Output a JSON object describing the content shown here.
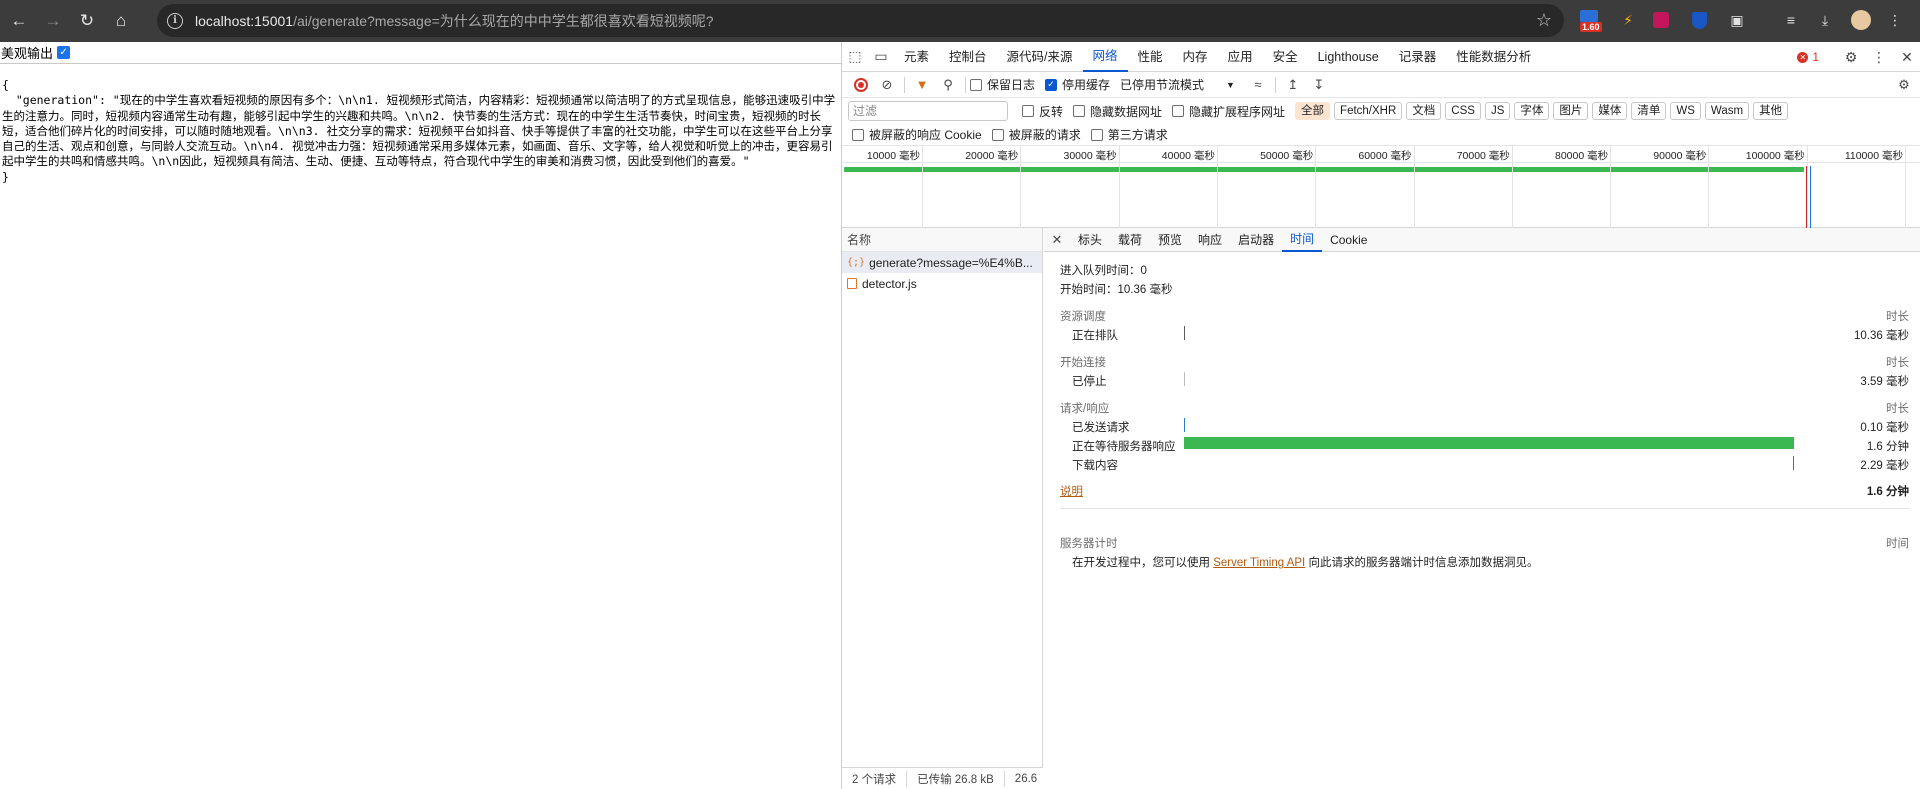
{
  "browser": {
    "url_host": "localhost:15001",
    "url_path": "/ai/generate?message=为什么现在的中中学生都很喜欢看短视频呢?",
    "ext_badge": "1.60"
  },
  "page": {
    "pretty_label": "美观输出",
    "json_text": "{\n  \"generation\": \"现在的中学生喜欢看短视频的原因有多个：\\n\\n1. 短视频形式简洁，内容精彩：短视频通常以简洁明了的方式呈现信息，能够迅速吸引中学生的注意力。同时，短视频内容通常生动有趣，能够引起中学生的兴趣和共鸣。\\n\\n2. 快节奏的生活方式：现在的中学生生活节奏快，时间宝贵，短视频的时长短，适合他们碎片化的时间安排，可以随时随地观看。\\n\\n3. 社交分享的需求：短视频平台如抖音、快手等提供了丰富的社交功能，中学生可以在这些平台上分享自己的生活、观点和创意，与同龄人交流互动。\\n\\n4. 视觉冲击力强：短视频通常采用多媒体元素，如画面、音乐、文字等，给人视觉和听觉上的冲击，更容易引起中学生的共鸣和情感共鸣。\\n\\n因此，短视频具有简洁、生动、便捷、互动等特点，符合现代中学生的审美和消费习惯，因此受到他们的喜爱。\"\n}"
  },
  "devtools": {
    "tabs": [
      "元素",
      "控制台",
      "源代码/来源",
      "网络",
      "性能",
      "内存",
      "应用",
      "安全",
      "Lighthouse",
      "记录器",
      "性能数据分析"
    ],
    "active_tab": "网络",
    "error_count": "1",
    "toolbar": {
      "preserve_log": "保留日志",
      "disable_cache": "停用缓存",
      "throttle": "已停用节流模式"
    },
    "filter": {
      "placeholder": "过滤",
      "invert": "反转",
      "hide_data_urls": "隐藏数据网址",
      "hide_ext_urls": "隐藏扩展程序网址",
      "types": [
        "全部",
        "Fetch/XHR",
        "文档",
        "CSS",
        "JS",
        "字体",
        "图片",
        "媒体",
        "清单",
        "WS",
        "Wasm",
        "其他"
      ],
      "blocked_cookies": "被屏蔽的响应 Cookie",
      "blocked_requests": "被屏蔽的请求",
      "third_party": "第三方请求"
    },
    "overview_ticks": [
      "10000 毫秒",
      "20000 毫秒",
      "30000 毫秒",
      "40000 毫秒",
      "50000 毫秒",
      "60000 毫秒",
      "70000 毫秒",
      "80000 毫秒",
      "90000 毫秒",
      "100000 毫秒",
      "110000 毫秒"
    ],
    "requests": {
      "header": "名称",
      "items": [
        "generate?message=%E4%B...",
        "detector.js"
      ]
    },
    "status": [
      "2 个请求",
      "已传输 26.8 kB",
      "26.6"
    ],
    "detail_tabs": [
      "标头",
      "载荷",
      "预览",
      "响应",
      "启动器",
      "时间",
      "Cookie"
    ],
    "active_detail_tab": "时间",
    "timing": {
      "queued_at": "进入队列时间：0",
      "started_at": "开始时间：10.36 毫秒",
      "sec_scheduling": "资源调度",
      "sec_connection": "开始连接",
      "sec_request": "请求/响应",
      "duration_header": "时长",
      "queueing_label": "正在排队",
      "queueing_val": "10.36 毫秒",
      "stalled_label": "已停止",
      "stalled_val": "3.59 毫秒",
      "sent_label": "已发送请求",
      "sent_val": "0.10 毫秒",
      "waiting_label": "正在等待服务器响应",
      "waiting_val": "1.6 分钟",
      "download_label": "下载内容",
      "download_val": "2.29 毫秒",
      "explain_link": "说明",
      "total": "1.6 分钟",
      "server_timing": "服务器计时",
      "server_time_header": "时间",
      "server_note_pre": "在开发过程中，您可以使用",
      "server_note_link": "Server Timing API",
      "server_note_post": "向此请求的服务器端计时信息添加数据洞见。"
    }
  }
}
